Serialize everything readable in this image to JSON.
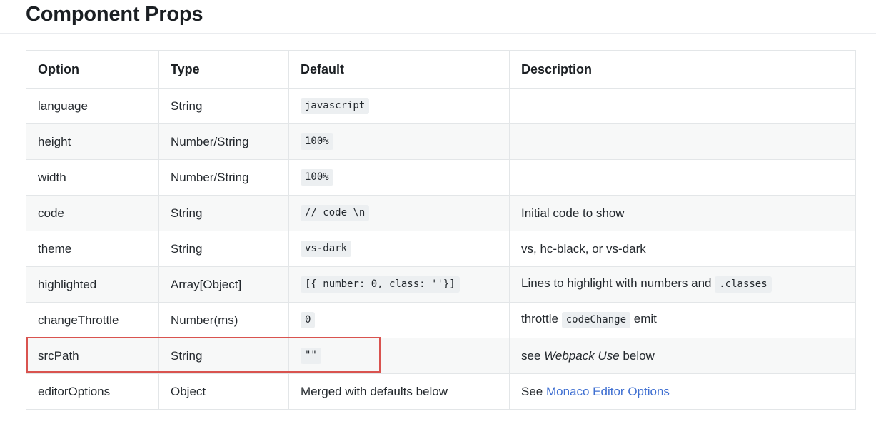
{
  "page": {
    "title": "Component Props"
  },
  "table": {
    "headers": [
      "Option",
      "Type",
      "Default",
      "Description"
    ],
    "rows": [
      {
        "option": "language",
        "type": "String",
        "default_code": "javascript",
        "description": ""
      },
      {
        "option": "height",
        "type": "Number/String",
        "default_code": "100%",
        "description": ""
      },
      {
        "option": "width",
        "type": "Number/String",
        "default_code": "100%",
        "description": ""
      },
      {
        "option": "code",
        "type": "String",
        "default_code": "// code \\n",
        "description": "Initial code to show"
      },
      {
        "option": "theme",
        "type": "String",
        "default_code": "vs-dark",
        "description": "vs, hc-black, or vs-dark"
      },
      {
        "option": "highlighted",
        "type": "Array[Object]",
        "default_code": "[{ number: 0, class: ''}]",
        "description_prefix": "Lines to highlight with numbers and",
        "description_code": ".classes"
      },
      {
        "option": "changeThrottle",
        "type": "Number(ms)",
        "default_code": "0",
        "description_prefix": "throttle",
        "description_code": "codeChange",
        "description_suffix": "emit"
      },
      {
        "option": "srcPath",
        "type": "String",
        "default_code": "\"\"",
        "description_prefix": "see",
        "description_italic": "Webpack Use",
        "description_suffix": "below"
      },
      {
        "option": "editorOptions",
        "type": "Object",
        "default_text": "Merged with defaults below",
        "description_prefix": "See",
        "description_link": "Monaco Editor Options"
      }
    ]
  },
  "annotation": {
    "highlight_color": "#d9534f",
    "highlighted_row": "srcPath"
  }
}
